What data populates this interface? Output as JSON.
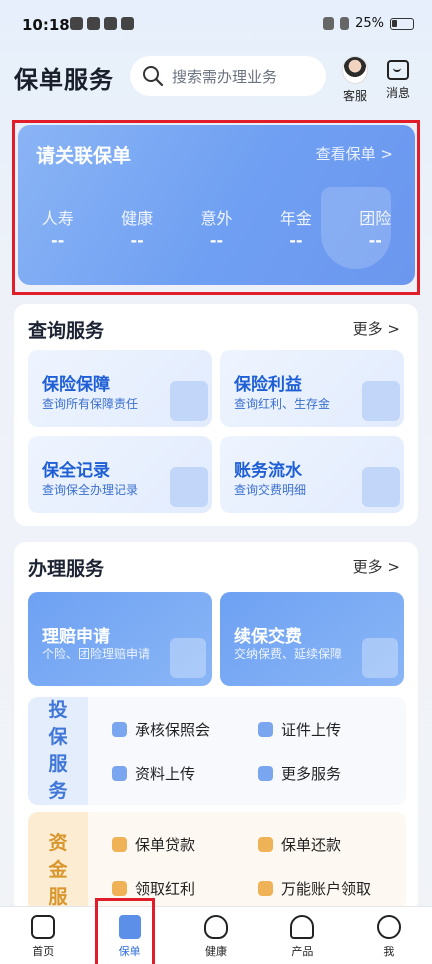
{
  "status_bar": {
    "time": "10:18",
    "battery": "25%"
  },
  "header": {
    "title": "保单服务",
    "search_placeholder": "搜索需办理业务",
    "service_label": "客服",
    "message_label": "消息"
  },
  "policy_card": {
    "title": "请关联保单",
    "view_link": "查看保单 >",
    "types": [
      {
        "label": "人寿",
        "value": "--"
      },
      {
        "label": "健康",
        "value": "--"
      },
      {
        "label": "意外",
        "value": "--"
      },
      {
        "label": "年金",
        "value": "--"
      },
      {
        "label": "团险",
        "value": "--"
      }
    ]
  },
  "query_section": {
    "title": "查询服务",
    "more": "更多 >",
    "tiles": [
      {
        "title": "保险保障",
        "subtitle": "查询所有保障责任"
      },
      {
        "title": "保险利益",
        "subtitle": "查询红利、生存金"
      },
      {
        "title": "保全记录",
        "subtitle": "查询保全办理记录"
      },
      {
        "title": "账务流水",
        "subtitle": "查询交费明细"
      }
    ]
  },
  "handle_section": {
    "title": "办理服务",
    "more": "更多 >",
    "big_tiles": [
      {
        "title": "理赔申请",
        "subtitle": "个险、团险理赔申请"
      },
      {
        "title": "续保交费",
        "subtitle": "交纳保费、延续保障"
      }
    ],
    "invest_group": {
      "label": [
        "投",
        "保",
        "服",
        "务"
      ],
      "items": [
        "承核保照会",
        "证件上传",
        "资料上传",
        "更多服务"
      ]
    },
    "fund_group": {
      "label": [
        "资",
        "金",
        "服"
      ],
      "items": [
        "保单贷款",
        "保单还款",
        "领取红利",
        "万能账户领取"
      ]
    }
  },
  "tabbar": {
    "tabs": [
      {
        "label": "首页",
        "icon": "home-icon"
      },
      {
        "label": "保单",
        "icon": "policy-icon"
      },
      {
        "label": "健康",
        "icon": "heart-icon"
      },
      {
        "label": "产品",
        "icon": "umbrella-icon"
      },
      {
        "label": "我",
        "icon": "user-icon"
      }
    ],
    "active": "保单"
  },
  "colors": {
    "accent": "#2f6fdb",
    "card_blue": "#6f9ff2",
    "highlight_red": "#e11d2a"
  }
}
